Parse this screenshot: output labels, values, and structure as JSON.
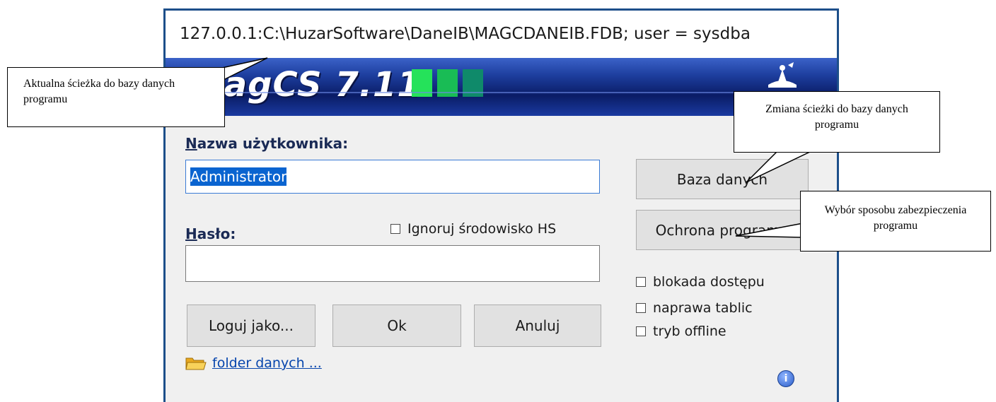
{
  "window": {
    "title": "127.0.0.1:C:\\HuzarSoftware\\DaneIB\\MAGCDANEIB.FDB; user = sysdba",
    "logo": "MagCS 7.11"
  },
  "form": {
    "username_label_first": "N",
    "username_label_rest": "azwa użytkownika:",
    "username_value": "Administrator",
    "password_label_first": "H",
    "password_label_rest": "asło:",
    "password_value": "",
    "ignore_env_label": "Ignoruj środowisko HS",
    "ignore_env_checked": false
  },
  "buttons": {
    "database": "Baza danych",
    "protection": "Ochrona programu",
    "login_as": "Loguj jako...",
    "ok": "Ok",
    "cancel": "Anuluj"
  },
  "options": [
    {
      "label": "blokada dostępu",
      "checked": false
    },
    {
      "label": "naprawa tablic",
      "checked": false
    },
    {
      "label": "tryb offline",
      "checked": false
    }
  ],
  "footer": {
    "folder_link": "folder danych ..."
  },
  "callouts": {
    "db_path": "Aktualna ścieżka do bazy danych programu",
    "change_path": "Zmiana ścieżki do bazy danych programu",
    "protection": "Wybór sposobu zabezpieczenia programu"
  },
  "icons": [
    "folder-icon",
    "info-icon",
    "emblem-icon"
  ],
  "colors": {
    "window_border": "#1d4f8a",
    "banner_dark": "#0a1c66",
    "selection": "#0a64d0",
    "link": "#0645ad"
  }
}
